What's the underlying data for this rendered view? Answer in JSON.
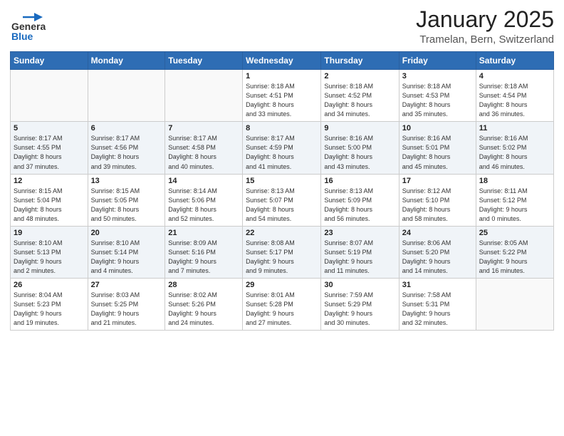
{
  "logo": {
    "general": "General",
    "blue": "Blue"
  },
  "header": {
    "month": "January 2025",
    "location": "Tramelan, Bern, Switzerland"
  },
  "days_of_week": [
    "Sunday",
    "Monday",
    "Tuesday",
    "Wednesday",
    "Thursday",
    "Friday",
    "Saturday"
  ],
  "weeks": [
    [
      {
        "day": "",
        "info": ""
      },
      {
        "day": "",
        "info": ""
      },
      {
        "day": "",
        "info": ""
      },
      {
        "day": "1",
        "info": "Sunrise: 8:18 AM\nSunset: 4:51 PM\nDaylight: 8 hours\nand 33 minutes."
      },
      {
        "day": "2",
        "info": "Sunrise: 8:18 AM\nSunset: 4:52 PM\nDaylight: 8 hours\nand 34 minutes."
      },
      {
        "day": "3",
        "info": "Sunrise: 8:18 AM\nSunset: 4:53 PM\nDaylight: 8 hours\nand 35 minutes."
      },
      {
        "day": "4",
        "info": "Sunrise: 8:18 AM\nSunset: 4:54 PM\nDaylight: 8 hours\nand 36 minutes."
      }
    ],
    [
      {
        "day": "5",
        "info": "Sunrise: 8:17 AM\nSunset: 4:55 PM\nDaylight: 8 hours\nand 37 minutes."
      },
      {
        "day": "6",
        "info": "Sunrise: 8:17 AM\nSunset: 4:56 PM\nDaylight: 8 hours\nand 39 minutes."
      },
      {
        "day": "7",
        "info": "Sunrise: 8:17 AM\nSunset: 4:58 PM\nDaylight: 8 hours\nand 40 minutes."
      },
      {
        "day": "8",
        "info": "Sunrise: 8:17 AM\nSunset: 4:59 PM\nDaylight: 8 hours\nand 41 minutes."
      },
      {
        "day": "9",
        "info": "Sunrise: 8:16 AM\nSunset: 5:00 PM\nDaylight: 8 hours\nand 43 minutes."
      },
      {
        "day": "10",
        "info": "Sunrise: 8:16 AM\nSunset: 5:01 PM\nDaylight: 8 hours\nand 45 minutes."
      },
      {
        "day": "11",
        "info": "Sunrise: 8:16 AM\nSunset: 5:02 PM\nDaylight: 8 hours\nand 46 minutes."
      }
    ],
    [
      {
        "day": "12",
        "info": "Sunrise: 8:15 AM\nSunset: 5:04 PM\nDaylight: 8 hours\nand 48 minutes."
      },
      {
        "day": "13",
        "info": "Sunrise: 8:15 AM\nSunset: 5:05 PM\nDaylight: 8 hours\nand 50 minutes."
      },
      {
        "day": "14",
        "info": "Sunrise: 8:14 AM\nSunset: 5:06 PM\nDaylight: 8 hours\nand 52 minutes."
      },
      {
        "day": "15",
        "info": "Sunrise: 8:13 AM\nSunset: 5:07 PM\nDaylight: 8 hours\nand 54 minutes."
      },
      {
        "day": "16",
        "info": "Sunrise: 8:13 AM\nSunset: 5:09 PM\nDaylight: 8 hours\nand 56 minutes."
      },
      {
        "day": "17",
        "info": "Sunrise: 8:12 AM\nSunset: 5:10 PM\nDaylight: 8 hours\nand 58 minutes."
      },
      {
        "day": "18",
        "info": "Sunrise: 8:11 AM\nSunset: 5:12 PM\nDaylight: 9 hours\nand 0 minutes."
      }
    ],
    [
      {
        "day": "19",
        "info": "Sunrise: 8:10 AM\nSunset: 5:13 PM\nDaylight: 9 hours\nand 2 minutes."
      },
      {
        "day": "20",
        "info": "Sunrise: 8:10 AM\nSunset: 5:14 PM\nDaylight: 9 hours\nand 4 minutes."
      },
      {
        "day": "21",
        "info": "Sunrise: 8:09 AM\nSunset: 5:16 PM\nDaylight: 9 hours\nand 7 minutes."
      },
      {
        "day": "22",
        "info": "Sunrise: 8:08 AM\nSunset: 5:17 PM\nDaylight: 9 hours\nand 9 minutes."
      },
      {
        "day": "23",
        "info": "Sunrise: 8:07 AM\nSunset: 5:19 PM\nDaylight: 9 hours\nand 11 minutes."
      },
      {
        "day": "24",
        "info": "Sunrise: 8:06 AM\nSunset: 5:20 PM\nDaylight: 9 hours\nand 14 minutes."
      },
      {
        "day": "25",
        "info": "Sunrise: 8:05 AM\nSunset: 5:22 PM\nDaylight: 9 hours\nand 16 minutes."
      }
    ],
    [
      {
        "day": "26",
        "info": "Sunrise: 8:04 AM\nSunset: 5:23 PM\nDaylight: 9 hours\nand 19 minutes."
      },
      {
        "day": "27",
        "info": "Sunrise: 8:03 AM\nSunset: 5:25 PM\nDaylight: 9 hours\nand 21 minutes."
      },
      {
        "day": "28",
        "info": "Sunrise: 8:02 AM\nSunset: 5:26 PM\nDaylight: 9 hours\nand 24 minutes."
      },
      {
        "day": "29",
        "info": "Sunrise: 8:01 AM\nSunset: 5:28 PM\nDaylight: 9 hours\nand 27 minutes."
      },
      {
        "day": "30",
        "info": "Sunrise: 7:59 AM\nSunset: 5:29 PM\nDaylight: 9 hours\nand 30 minutes."
      },
      {
        "day": "31",
        "info": "Sunrise: 7:58 AM\nSunset: 5:31 PM\nDaylight: 9 hours\nand 32 minutes."
      },
      {
        "day": "",
        "info": ""
      }
    ]
  ]
}
